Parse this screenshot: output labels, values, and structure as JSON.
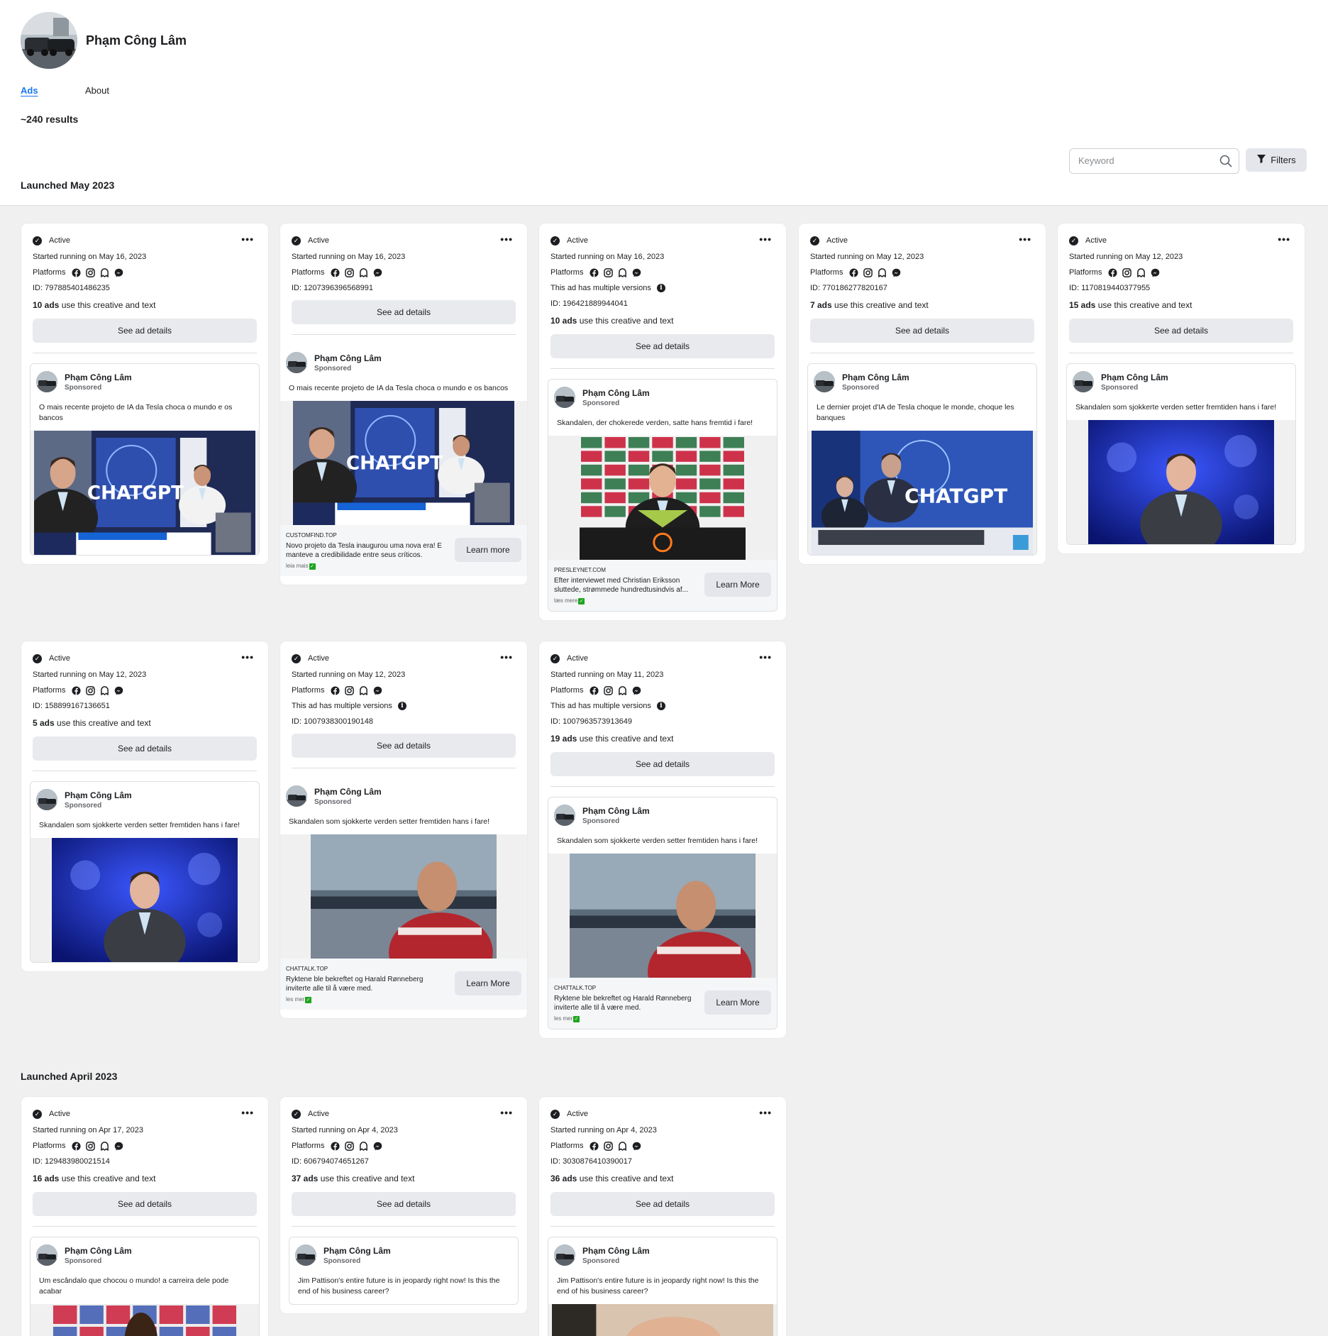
{
  "page": {
    "name": "Phạm Công Lâm",
    "results": "~240 results"
  },
  "tabs": {
    "ads": "Ads",
    "about": "About"
  },
  "search": {
    "placeholder": "Keyword",
    "filters": "Filters"
  },
  "sections": {
    "may": "Launched May 2023",
    "april": "Launched April 2023"
  },
  "labels": {
    "active": "Active",
    "platforms": "Platforms",
    "multiple_versions": "This ad has multiple versions",
    "use_creative": " use this creative and text",
    "see_details": "See ad details",
    "sponsored": "Sponsored",
    "advertiser": "Phạm Công Lâm"
  },
  "colors": {
    "accent": "#1877f2",
    "page_bg": "#f0f0f0",
    "button_bg": "#e4e6eb"
  },
  "cards": [
    {
      "started": "Started running on May 16, 2023",
      "id": "ID: 797885401486235",
      "ads": "10 ads",
      "text": "O mais recente projeto de IA da Tesla choca o mundo e os bancos",
      "image": "chatgpt-news-studio"
    },
    {
      "started": "Started running on May 16, 2023",
      "id": "ID: 1207396396568991",
      "ads": "",
      "text": "O mais recente projeto de IA da Tesla choca o mundo e os bancos",
      "image": "chatgpt-news-studio",
      "cta_domain": "CUSTOMFIND.TOP",
      "cta_text": "Novo projeto da Tesla inaugurou uma nova era! E manteve a credibilidade entre seus críticos.",
      "cta_more": "leia mais",
      "cta_btn": "Learn more"
    },
    {
      "started": "Started running on May 16, 2023",
      "id": "ID: 196421889944041",
      "ads": "10 ads",
      "text": "Skandalen, der chokerede verden, satte hans fremtid i fare!",
      "image": "press-conference",
      "cta_domain": "PRESLEYNET.COM",
      "cta_text": "Efter interviewet med Christian Eriksson sluttede, strømmede hundredtusindvis af...",
      "cta_more": "læs mere",
      "cta_btn": "Learn More"
    },
    {
      "started": "Started running on May 12, 2023",
      "id": "ID: 770186277820167",
      "ads": "7 ads",
      "text": "Le dernier projet d'IA de Tesla choque le monde, choque les banques",
      "image": "chatgpt-news-fr"
    },
    {
      "started": "Started running on May 12, 2023",
      "id": "ID: 1170819440377955",
      "ads": "15 ads",
      "text": "Skandalen som sjokkerte verden setter fremtiden hans i fare!",
      "image": "portrait-blue"
    },
    {
      "started": "Started running on May 12, 2023",
      "id": "ID: 158899167136651",
      "ads": "5 ads",
      "text": "Skandalen som sjokkerte verden setter fremtiden hans i fare!",
      "image": "portrait-blue"
    },
    {
      "started": "Started running on May 12, 2023",
      "id": "ID: 1007938300190148",
      "ads": "",
      "text": "Skandalen som sjokkerte verden setter fremtiden hans i fare!",
      "image": "portrait-outdoor",
      "cta_domain": "CHATTALK.TOP",
      "cta_text": "Ryktene ble bekreftet og Harald Rønneberg inviterte alle til å være med.",
      "cta_more": "les mer",
      "cta_btn": "Learn More"
    },
    {
      "started": "Started running on May 11, 2023",
      "id": "ID: 1007963573913649",
      "ads": "19 ads",
      "text": "Skandalen som sjokkerte verden setter fremtiden hans i fare!",
      "image": "portrait-outdoor",
      "cta_domain": "CHATTALK.TOP",
      "cta_text": "Ryktene ble bekreftet og Harald Rønneberg inviterte alle til å være med.",
      "cta_more": "les mer",
      "cta_btn": "Learn More"
    },
    {
      "started": "Started running on Apr 17, 2023",
      "id": "ID: 129483980021514",
      "ads": "16 ads",
      "text": "Um escândalo que chocou o mundo! a carreira dele pode acabar",
      "image": "press-wall"
    },
    {
      "started": "Started running on Apr 4, 2023",
      "id": "ID: 606794074651267",
      "ads": "37 ads",
      "text": "Jim Pattison's entire future is in jeopardy right now! Is this the end of his business career?",
      "image": "none"
    },
    {
      "started": "Started running on Apr 4, 2023",
      "id": "ID: 3030876410390017",
      "ads": "36 ads",
      "text": "Jim Pattison's entire future is in jeopardy right now! Is this the end of his business career?",
      "image": "portrait-partial"
    }
  ]
}
